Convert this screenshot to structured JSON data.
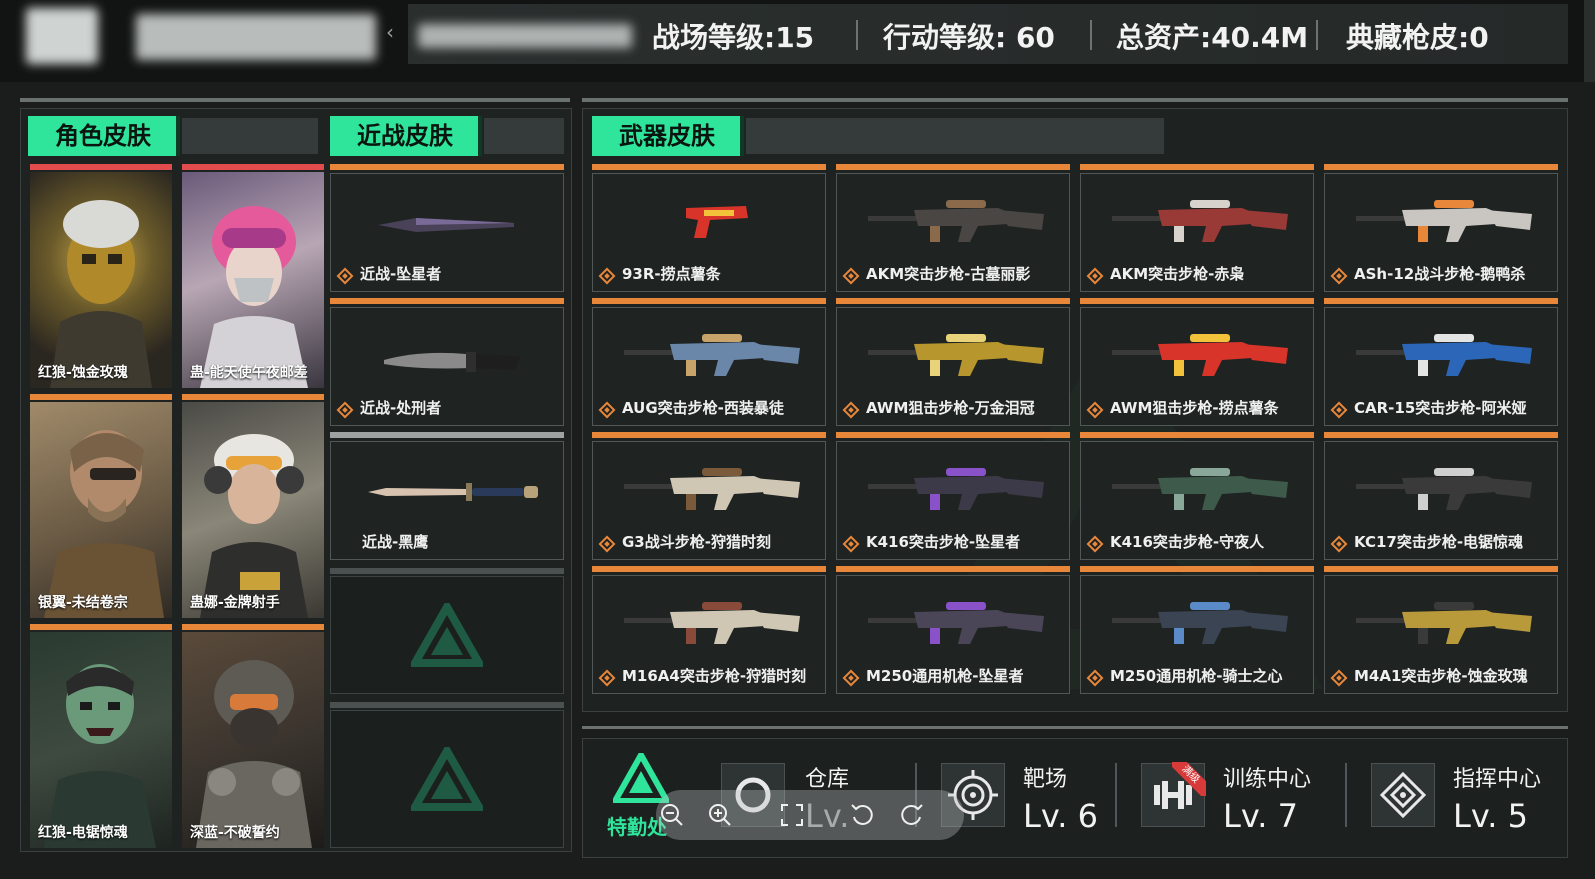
{
  "header": {
    "collapse_glyph": "‹",
    "stats": [
      {
        "label": "战场等级:15"
      },
      {
        "label": "行动等级: 60"
      },
      {
        "label": "总资产:40.4M"
      },
      {
        "label": "典藏枪皮:0"
      }
    ]
  },
  "sections": {
    "character": "角色皮肤",
    "melee": "近战皮肤",
    "weapon": "武器皮肤"
  },
  "character_skins": [
    {
      "name": "红狼-蚀金玫瑰",
      "rarity_color": "#e24c4c"
    },
    {
      "name": "蛊-能天使午夜邮差",
      "rarity_color": "#e24c4c"
    },
    {
      "name": "银翼-未结卷宗",
      "rarity_color": "#e8873a"
    },
    {
      "name": "蛊娜-金牌射手",
      "rarity_color": "#e8873a"
    },
    {
      "name": "红狼-电锯惊魂",
      "rarity_color": "#e8873a"
    },
    {
      "name": "深蓝-不破誓约",
      "rarity_color": "#e8873a"
    }
  ],
  "melee_skins": [
    {
      "name": "近战-坠星者",
      "rarity_color": "#e8873a"
    },
    {
      "name": "近战-处刑者",
      "rarity_color": "#e8873a"
    },
    {
      "name": "近战-黑鹰",
      "rarity_color": "#9ea3a2"
    }
  ],
  "weapon_skins": [
    {
      "name": "93R-捞点薯条",
      "rarity_color": "#e8873a",
      "gun_color": "#d8342a",
      "accent": "#f2c23a"
    },
    {
      "name": "AKM突击步枪-古墓丽影",
      "rarity_color": "#e8873a",
      "gun_color": "#4a4644",
      "accent": "#8a6a4a"
    },
    {
      "name": "AKM突击步枪-赤枭",
      "rarity_color": "#e8873a",
      "gun_color": "#9a3a36",
      "accent": "#d8d2cc"
    },
    {
      "name": "ASh-12战斗步枪-鹅鸭杀",
      "rarity_color": "#e8873a",
      "gun_color": "#c9c6c2",
      "accent": "#e8873a"
    },
    {
      "name": "AUG突击步枪-西装暴徒",
      "rarity_color": "#e8873a",
      "gun_color": "#6a86a8",
      "accent": "#c9a46a"
    },
    {
      "name": "AWM狙击步枪-万金泪冠",
      "rarity_color": "#e8873a",
      "gun_color": "#b8962e",
      "accent": "#e8d27a"
    },
    {
      "name": "AWM狙击步枪-捞点薯条",
      "rarity_color": "#e8873a",
      "gun_color": "#d8342a",
      "accent": "#f2c23a"
    },
    {
      "name": "CAR-15突击步枪-阿米娅",
      "rarity_color": "#e8873a",
      "gun_color": "#2c66b8",
      "accent": "#e4e4e4"
    },
    {
      "name": "G3战斗步枪-狩猎时刻",
      "rarity_color": "#e8873a",
      "gun_color": "#cfc6b4",
      "accent": "#7a5a3a"
    },
    {
      "name": "K416突击步枪-坠星者",
      "rarity_color": "#e8873a",
      "gun_color": "#3c3a48",
      "accent": "#8a52c8"
    },
    {
      "name": "K416突击步枪-守夜人",
      "rarity_color": "#e8873a",
      "gun_color": "#3e5a4a",
      "accent": "#8aa89a"
    },
    {
      "name": "KC17突击步枪-电锯惊魂",
      "rarity_color": "#e8873a",
      "gun_color": "#3a3a3a",
      "accent": "#cfcfcf"
    },
    {
      "name": "M16A4突击步枪-狩猎时刻",
      "rarity_color": "#e8873a",
      "gun_color": "#cfc6b4",
      "accent": "#8a4a3a"
    },
    {
      "name": "M250通用机枪-坠星者",
      "rarity_color": "#e8873a",
      "gun_color": "#4a4658",
      "accent": "#8a52c8"
    },
    {
      "name": "M250通用机枪-骑士之心",
      "rarity_color": "#e8873a",
      "gun_color": "#3a4452",
      "accent": "#5a8ac8"
    },
    {
      "name": "M4A1突击步枪-蚀金玫瑰",
      "rarity_color": "#e8873a",
      "gun_color": "#b89a3a",
      "accent": "#3a3a3a"
    }
  ],
  "facilities": {
    "logo_text": "特勤处",
    "items": [
      {
        "title": "仓库",
        "level": "Lv."
      },
      {
        "title": "靶场",
        "level": "Lv. 6"
      },
      {
        "title": "训练中心",
        "level": "Lv. 7",
        "badge": "满级"
      },
      {
        "title": "指挥中心",
        "level": "Lv. 5"
      }
    ]
  },
  "colors": {
    "accent_green": "#2ee59b",
    "rarity_red": "#e24c4c",
    "rarity_orange": "#e8873a",
    "rarity_gray": "#9ea3a2"
  }
}
